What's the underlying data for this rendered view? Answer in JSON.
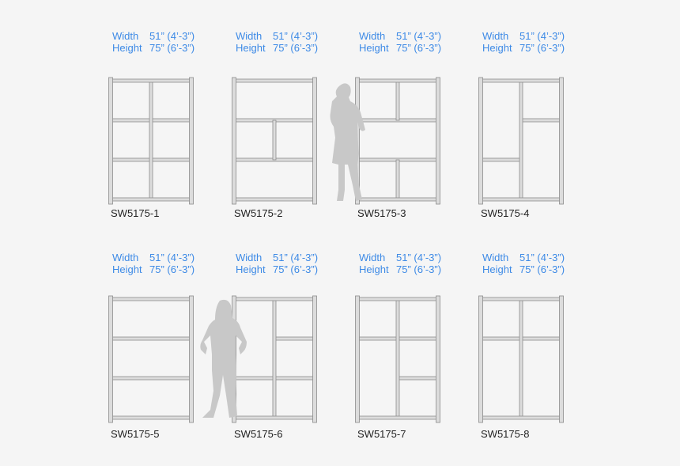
{
  "panels": [
    {
      "code": "SW5175-1",
      "width_label": "Width",
      "width_value": "51” (4’-3”)",
      "height_label": "Height",
      "height_value": "75” (6’-3”)",
      "layout": "2x3-grid"
    },
    {
      "code": "SW5175-2",
      "width_label": "Width",
      "width_value": "51” (4’-3”)",
      "height_label": "Height",
      "height_value": "75” (6’-3”)",
      "layout": "full-split-full"
    },
    {
      "code": "SW5175-3",
      "width_label": "Width",
      "width_value": "51” (4’-3”)",
      "height_label": "Height",
      "height_value": "75” (6’-3”)",
      "layout": "split-full-split"
    },
    {
      "code": "SW5175-4",
      "width_label": "Width",
      "width_value": "51” (4’-3”)",
      "height_label": "Height",
      "height_value": "75” (6’-3”)",
      "layout": "offset-columns"
    },
    {
      "code": "SW5175-5",
      "width_label": "Width",
      "width_value": "51” (4’-3”)",
      "height_label": "Height",
      "height_value": "75” (6’-3”)",
      "layout": "three-rows"
    },
    {
      "code": "SW5175-6",
      "width_label": "Width",
      "width_value": "51” (4’-3”)",
      "height_label": "Height",
      "height_value": "75” (6’-3”)",
      "layout": "tall-left-three-right"
    },
    {
      "code": "SW5175-7",
      "width_label": "Width",
      "width_value": "51” (4’-3”)",
      "height_label": "Height",
      "height_value": "75” (6’-3”)",
      "layout": "top-split-right-stack"
    },
    {
      "code": "SW5175-8",
      "width_label": "Width",
      "width_value": "51” (4’-3”)",
      "height_label": "Height",
      "height_value": "75” (6’-3”)",
      "layout": "two-columns-top-split"
    }
  ],
  "colors": {
    "dimension_text": "#3d8ae6",
    "frame": "#a8a8a8",
    "silhouette": "#c8c8c8"
  }
}
